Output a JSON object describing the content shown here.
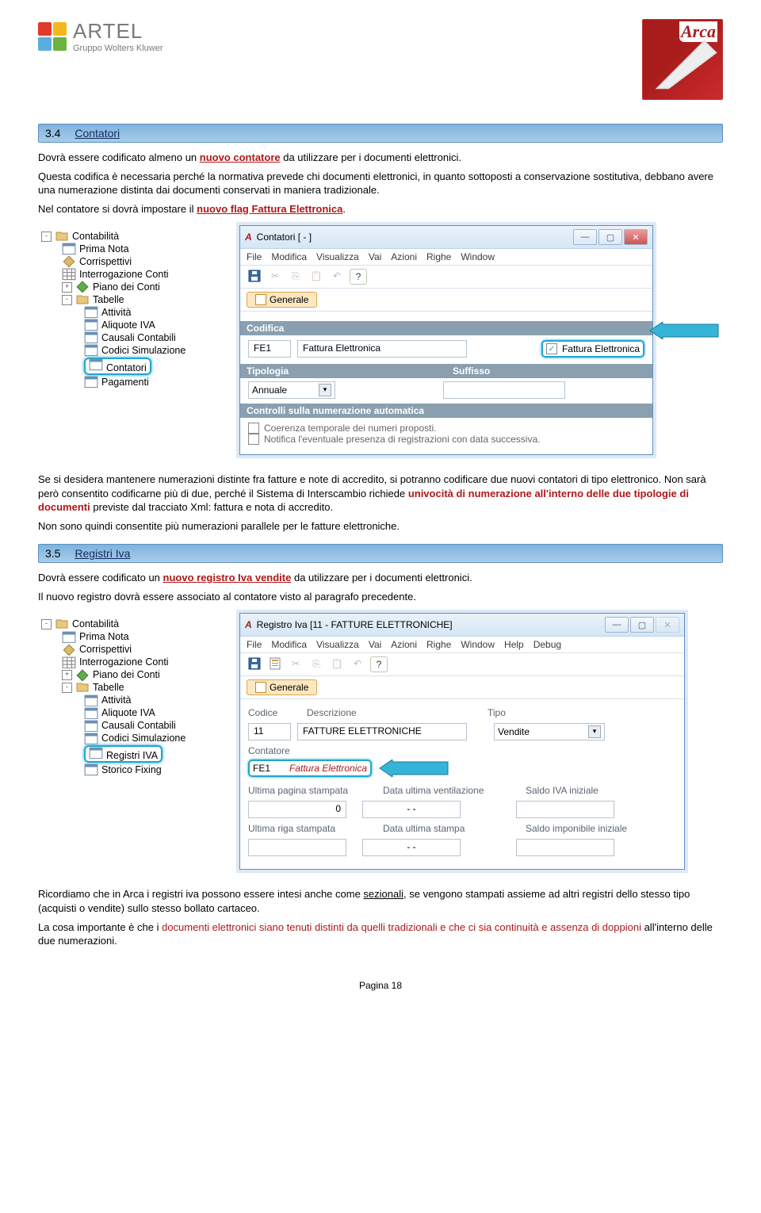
{
  "header": {
    "brand": "ARTEL",
    "brand_sub": "Gruppo Wolters Kluwer",
    "arca": "Arca"
  },
  "section1": {
    "num": "3.4",
    "title": "Contatori",
    "p1a": "Dovrà essere codificato almeno un ",
    "p1b": "nuovo contatore",
    "p1c": " da utilizzare per i documenti elettronici.",
    "p2": "Questa codifica è necessaria perché la normativa prevede chi documenti elettronici, in quanto sottoposti a conservazione sostitutiva, debbano avere una numerazione distinta dai documenti conservati in maniera tradizionale.",
    "p3a": "Nel contatore si dovrà impostare il ",
    "p3b": "nuovo flag Fattura Elettronica",
    "p3c": ".",
    "p4": "Se si desidera mantenere numerazioni distinte fra fatture e note di accredito, si potranno codificare due nuovi contatori di tipo elettronico. Non sarà però consentito codificarne più di due, perché il Sistema di Interscambio richiede ",
    "p4b": "univocità di numerazione all'interno delle due tipologie di documenti",
    "p4c": " previste dal tracciato Xml: fattura e nota di accredito.",
    "p5": "Non sono quindi consentite più numerazioni parallele per le fatture elettroniche."
  },
  "section2": {
    "num": "3.5",
    "title": "Registri Iva",
    "p1a": "Dovrà essere codificato un ",
    "p1b": "nuovo registro Iva vendite",
    "p1c": " da utilizzare per i documenti elettronici.",
    "p2": "Il nuovo registro dovrà essere associato al contatore visto al paragrafo precedente.",
    "p3a": "Ricordiamo che in Arca i registri iva possono essere intesi anche come ",
    "p3b": "sezionali",
    "p3c": ", se vengono stampati assieme ad altri registri dello stesso tipo (acquisti o vendite) sullo stesso bollato cartaceo.",
    "p4a": "La cosa importante è che i ",
    "p4b": "documenti elettronici siano tenuti distinti da quelli tradizionali e che ci sia continuità e assenza di doppioni",
    "p4c": " all'interno delle due numerazioni."
  },
  "tree1": {
    "root": "Contabilità",
    "items": [
      "Prima Nota",
      "Corrispettivi",
      "Interrogazione Conti",
      "Piano dei Conti",
      "Tabelle"
    ],
    "sub": [
      "Attività",
      "Aliquote IVA",
      "Causali Contabili",
      "Codici Simulazione",
      "Contatori",
      "Pagamenti"
    ]
  },
  "tree2": {
    "root": "Contabilità",
    "items": [
      "Prima Nota",
      "Corrispettivi",
      "Interrogazione Conti",
      "Piano dei Conti",
      "Tabelle"
    ],
    "sub": [
      "Attività",
      "Aliquote IVA",
      "Causali Contabili",
      "Codici Simulazione",
      "Registri IVA",
      "Storico Fixing"
    ]
  },
  "win1": {
    "title": "Contatori [ - ]",
    "menu": [
      "File",
      "Modifica",
      "Visualizza",
      "Vai",
      "Azioni",
      "Righe",
      "Window"
    ],
    "tab": "Generale",
    "grp_codifica": "Codifica",
    "codice": "FE1",
    "desc": "Fattura Elettronica",
    "flag": "Fattura Elettronica",
    "grp_tipologia": "Tipologia",
    "grp_suffisso": "Suffisso",
    "tipologia_val": "Annuale",
    "grp_controlli": "Controlli sulla numerazione automatica",
    "chk1": "Coerenza temporale dei numeri proposti.",
    "chk2": "Notifica l'eventuale presenza di registrazioni con data successiva."
  },
  "win2": {
    "title": "Registro Iva [11 - FATTURE ELETTRONICHE]",
    "menu": [
      "File",
      "Modifica",
      "Visualizza",
      "Vai",
      "Azioni",
      "Righe",
      "Window",
      "Help",
      "Debug"
    ],
    "tab": "Generale",
    "lbl_codice": "Codice",
    "lbl_desc": "Descrizione",
    "lbl_tipo": "Tipo",
    "codice": "11",
    "desc": "FATTURE ELETTRONICHE",
    "tipo": "Vendite",
    "lbl_contatore": "Contatore",
    "cont_code": "FE1",
    "cont_desc": "Fattura Elettronica",
    "lbl_upag": "Ultima pagina stampata",
    "lbl_dvent": "Data ultima ventilazione",
    "lbl_sivaini": "Saldo IVA iniziale",
    "val_upag": "0",
    "val_dvent": "- -",
    "lbl_uriga": "Ultima riga stampata",
    "lbl_dult": "Data ultima stampa",
    "lbl_simpini": "Saldo imponibile iniziale",
    "val_dult": "- -"
  },
  "footer": "Pagina 18"
}
